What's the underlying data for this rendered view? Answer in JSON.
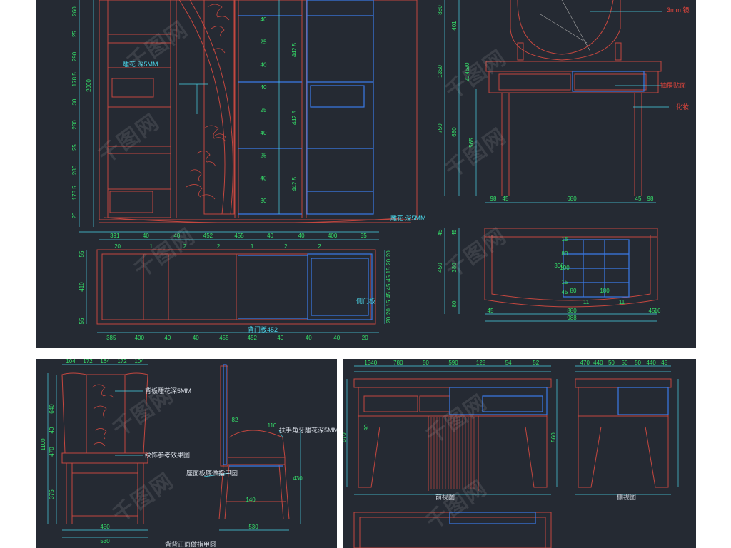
{
  "watermark": "千图网",
  "panel_top_left": {
    "dims_top_vertical": [
      "260",
      "25",
      "290",
      "178.5",
      "30",
      "280",
      "25",
      "280",
      "178.5",
      "20"
    ],
    "dim_overall_height": "2000",
    "dims_bottom_row": [
      "391",
      "40",
      "40",
      "452",
      "455",
      "40",
      "40",
      "400",
      "55"
    ],
    "dims_bottom_small": [
      "20",
      "1",
      "2",
      "2",
      "1",
      "2",
      "2"
    ],
    "dims_shelf": [
      "442.5",
      "442.5",
      "442.5"
    ],
    "dims_small": [
      "40",
      "25",
      "40",
      "40",
      "25",
      "40",
      "25",
      "40",
      "30"
    ],
    "carving_note_1": "雕花 深5MM",
    "carving_note_2": "雕花 深5MM",
    "plan_dims_vertical": [
      "55",
      "410",
      "55"
    ],
    "plan_dims_bottom": [
      "385",
      "400",
      "40",
      "40",
      "455",
      "452",
      "40",
      "40",
      "40",
      "20"
    ],
    "plan_dims_right": [
      "20",
      "20",
      "15",
      "45",
      "45",
      "45",
      "15",
      "20",
      "20"
    ],
    "plan_label_side": "侧门板",
    "plan_label_bottom": "背门板452"
  },
  "panel_top_right": {
    "note_mirror": "3mm 镜",
    "note_drawer": "抽屉贴面",
    "note_makeup": "化妆",
    "dims_left": [
      "880",
      "401",
      "20",
      "45",
      "20",
      "1350",
      "750",
      "680",
      "565"
    ],
    "dims_bottom": [
      "98",
      "45",
      "680",
      "45",
      "98"
    ],
    "plan_dims_left": [
      "45",
      "450",
      "380",
      "45",
      "80"
    ],
    "plan_dims_inner": [
      "300",
      "15",
      "80",
      "100",
      "15",
      "45",
      "80",
      "180",
      "11",
      "11"
    ],
    "plan_dims_bottom": [
      "45",
      "880",
      "45",
      "16",
      "988"
    ]
  },
  "panel_bottom_left": {
    "note_1": "背板雕花深5MM",
    "note_2": "纹饰参考效果图",
    "note_3": "座面板底做指甲圆",
    "note_4": "背背正面做指甲圆",
    "note_5": "扶手角牙雕花深5MM",
    "dims_top": [
      "104",
      "172",
      "164",
      "172",
      "104"
    ],
    "dims_left": [
      "1100",
      "640",
      "40",
      "470",
      "375"
    ],
    "dims_bottom": [
      "450",
      "530"
    ],
    "dims_side": [
      "110",
      "82",
      "430",
      "140",
      "530"
    ]
  },
  "panel_bottom_right": {
    "view_label_front": "前视图",
    "view_label_side": "侧视图",
    "dims_top": [
      "1340",
      "780",
      "50",
      "590",
      "128",
      "54",
      "52"
    ],
    "dims_side": [
      "570",
      "560",
      "90"
    ],
    "dims_right": [
      "470",
      "440",
      "50",
      "50",
      "50",
      "440",
      "45"
    ]
  }
}
